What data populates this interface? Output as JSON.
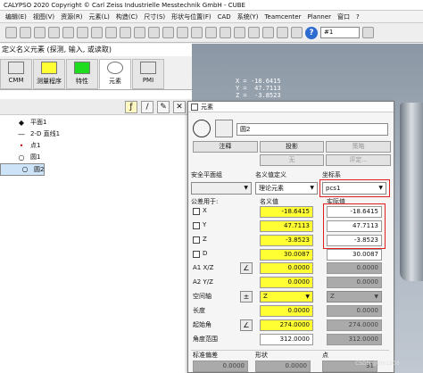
{
  "window": {
    "title": "CALYPSO 2020 Copyright © Carl Zeiss Industrielle Messtechnik GmbH - CUBE"
  },
  "menu": [
    "编辑(E)",
    "视图(V)",
    "资源(R)",
    "元素(L)",
    "构造(C)",
    "尺寸(S)",
    "形状与位置(F)",
    "CAD",
    "系统(Y)",
    "Teamcenter",
    "Planner",
    "窗口",
    "?"
  ],
  "toolbar": {
    "program_field": "#1"
  },
  "left": {
    "header": "定义名义元素 (探测, 输入, 或读取)",
    "tabs": [
      "CMM",
      "测量程序",
      "特性",
      "元素",
      "PMI"
    ],
    "tree": [
      {
        "icon": "plane",
        "label": "平面1"
      },
      {
        "icon": "line",
        "label": "2-D 直线1"
      },
      {
        "icon": "point",
        "label": "点1"
      },
      {
        "icon": "circle",
        "label": "圆1"
      },
      {
        "icon": "circle",
        "label": "圆2"
      }
    ]
  },
  "cad": {
    "coords": "X = -18.6415\nY =  47.7113\nZ =  -3.8523"
  },
  "dialog": {
    "title": "元素",
    "name": "圆2",
    "buttons": [
      "注释",
      "投影",
      "策略"
    ],
    "buttons2": [
      "",
      "无",
      "评定..."
    ],
    "safety_label": "安全平面组",
    "nominal_def_label": "名义值定义",
    "coord_label": "坐标系",
    "nominal_def_value": "理论元素",
    "coord_value": "pcs1",
    "tolerance_label": "公差用于:",
    "nominal_header": "名义值",
    "actual_header": "实际值",
    "rows": [
      {
        "label": "X",
        "nominal": "-18.6415",
        "actual": "-18.6415"
      },
      {
        "label": "Y",
        "nominal": "47.7113",
        "actual": "47.7113"
      },
      {
        "label": "Z",
        "nominal": "-3.8523",
        "actual": "-3.8523"
      },
      {
        "label": "D",
        "nominal": "30.0087",
        "actual": "30.0087"
      },
      {
        "label": "A1 X/Z",
        "nominal": "0.0000",
        "actual": "0.0000"
      },
      {
        "label": "A2 Y/Z",
        "nominal": "0.0000",
        "actual": "0.0000"
      },
      {
        "label": "空间轴",
        "nominal": "Z",
        "actual": "Z"
      },
      {
        "label": "长度",
        "nominal": "0.0000",
        "actual": "0.0000"
      },
      {
        "label": "起始角",
        "nominal": "274.0000",
        "actual": "274.0000"
      },
      {
        "label": "角度范围",
        "nominal": "312.0000",
        "actual": "312.0000"
      }
    ],
    "footer": [
      "标准偏差",
      "形状",
      "点"
    ],
    "footer_values": [
      "0.0000",
      "0.0000",
      "31"
    ]
  },
  "watermark": "CSDN @Jim1200"
}
